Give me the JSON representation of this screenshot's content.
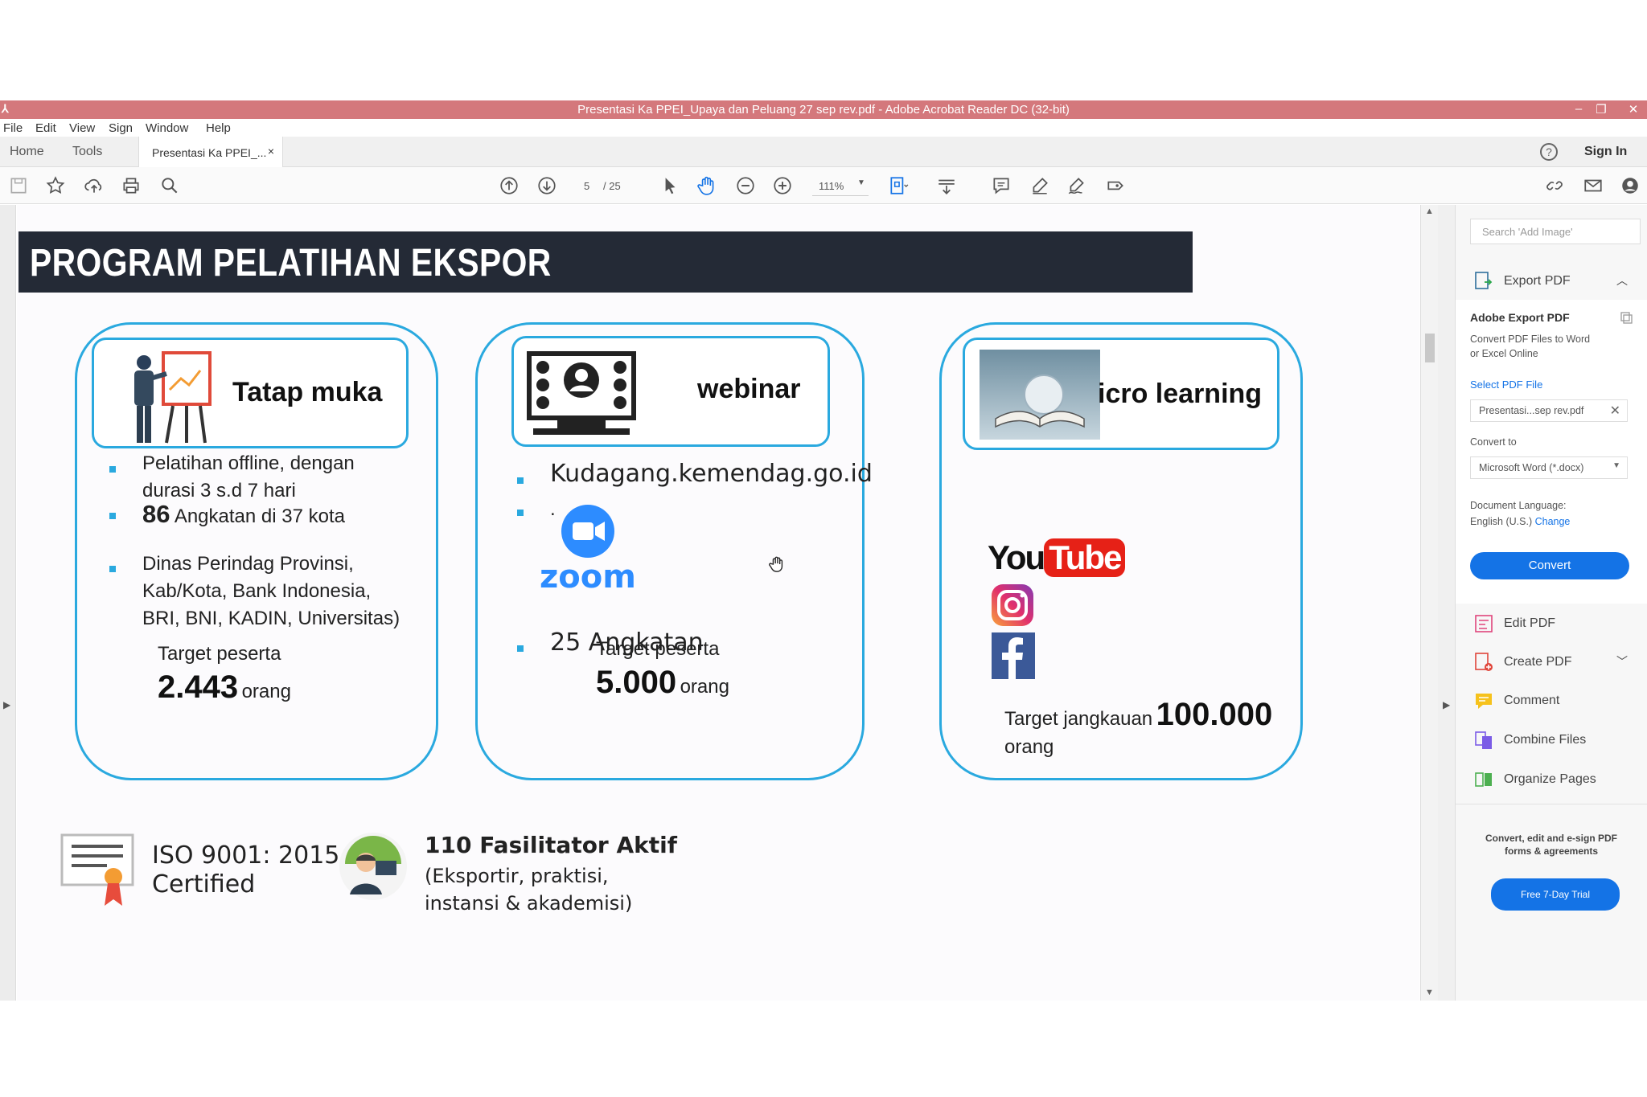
{
  "window": {
    "title": "Presentasi Ka PPEI_Upaya dan Peluang 27 sep rev.pdf - Adobe Acrobat Reader DC (32-bit)",
    "controls": [
      "–",
      "❐",
      "✕"
    ]
  },
  "menu": [
    "File",
    "Edit",
    "View",
    "Sign",
    "Window",
    "Help"
  ],
  "tabs": {
    "home": "Home",
    "tools": "Tools",
    "doc_tab": "Presentasi Ka PPEI_...",
    "close": "×",
    "sign_in": "Sign In"
  },
  "toolbar": {
    "page_current": "5",
    "page_total": "/ 25",
    "zoom": "111%"
  },
  "slide": {
    "title": "PROGRAM PELATIHAN EKSPOR",
    "cards": [
      {
        "title": "Tatap muka",
        "bullets": [
          {
            "line1": "Pelatihan offline, dengan",
            "line2": "durasi 3 s.d 7 hari"
          },
          {
            "num": "86",
            "text": "Angkatan di 37 kota"
          },
          {
            "line1": "Dinas Perindag Provinsi,",
            "line2": "Kab/Kota, Bank Indonesia,",
            "line3": "BRI, BNI, KADIN, Universitas)"
          }
        ],
        "target_label": "Target peserta",
        "target_value": "2.443",
        "target_unit": "orang"
      },
      {
        "title": "webinar",
        "bullets": [
          "Kudagang.kemendag.go.id",
          ".",
          "25 Angkatan"
        ],
        "zoom_label": "zoom",
        "target_label": "Target peserta",
        "target_value": "5.000",
        "target_unit": "orang"
      },
      {
        "title": "icro learning",
        "youtube_you": "You",
        "youtube_tube": "Tube",
        "target_label": "Target jangkauan",
        "target_value": "100.000",
        "target_unit": "orang"
      }
    ],
    "iso_line1": "ISO 9001: 2015",
    "iso_line2": "Certified",
    "fasilitator_title": "110 Fasilitator Aktif",
    "fasilitator_line1": "(Eksportir, praktisi,",
    "fasilitator_line2": "instansi & akademisi)"
  },
  "right_panel": {
    "search_placeholder": "Search 'Add Image'",
    "export_pdf": "Export PDF",
    "adobe_export_title": "Adobe Export PDF",
    "adobe_export_desc1": "Convert PDF Files to Word",
    "adobe_export_desc2": "or Excel Online",
    "select_pdf_file": "Select PDF File",
    "selected_file": "Presentasi...sep rev.pdf",
    "convert_to_label": "Convert to",
    "convert_to_value": "Microsoft Word (*.docx)",
    "doc_language_label": "Document Language:",
    "doc_language_value": "English (U.S.)",
    "change_link": "Change",
    "convert_button": "Convert",
    "tools": [
      "Edit PDF",
      "Create PDF",
      "Comment",
      "Combine Files",
      "Organize Pages"
    ],
    "promo_line1": "Convert, edit and e-sign PDF",
    "promo_line2": "forms & agreements",
    "trial_button": "Free 7-Day Trial"
  },
  "colors": {
    "titlebar": "#d4787c",
    "accent_blue": "#1473e6",
    "slide_blue": "#2aa9df",
    "slide_header": "#242a36"
  }
}
